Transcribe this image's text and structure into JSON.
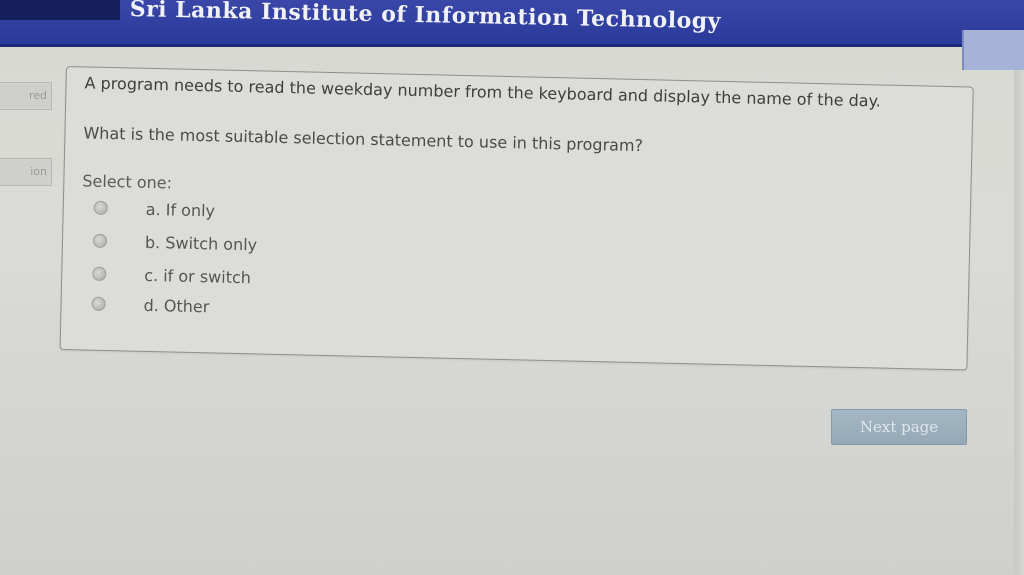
{
  "header": {
    "title": "Sri Lanka Institute of Information Technology"
  },
  "sidebar": {
    "tabs": [
      {
        "label": "red"
      },
      {
        "label": "ion"
      }
    ]
  },
  "question": {
    "text": "A program needs to read the weekday number from the keyboard and display the name of the day.",
    "ask": "What is the most suitable selection statement to use in this program?",
    "select_prompt": "Select one:",
    "options": [
      {
        "label": "a. If only"
      },
      {
        "label": "b. Switch only"
      },
      {
        "label": "c. if or switch"
      },
      {
        "label": "d. Other"
      }
    ]
  },
  "navigation": {
    "next_label": "Next page"
  }
}
